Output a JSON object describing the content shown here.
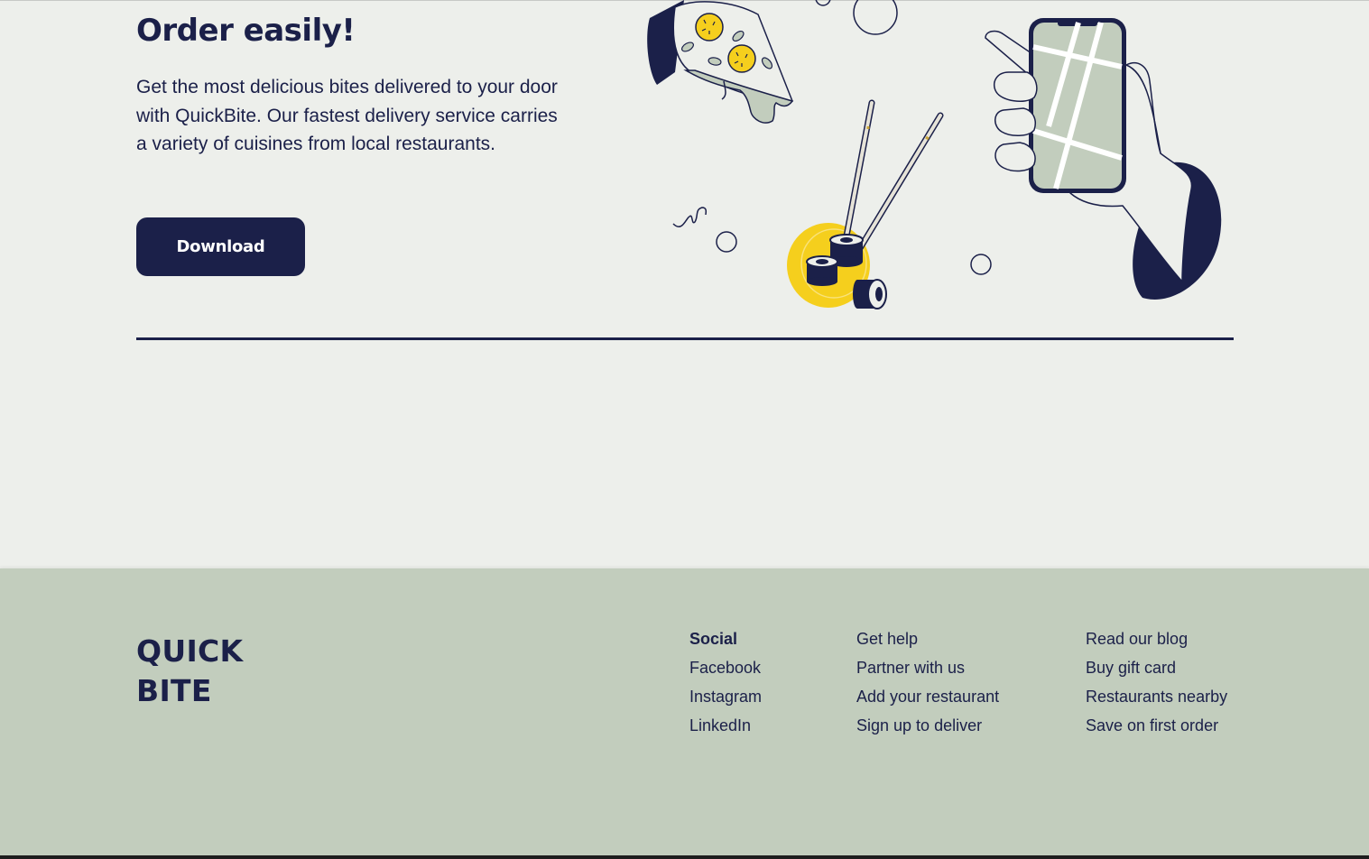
{
  "hero": {
    "title": "Order easily!",
    "description": "Get the most delicious bites delivered to your door with QuickBite. Our fastest delivery service carries a variety of cuisines from local restaurants.",
    "download_label": "Download"
  },
  "footer": {
    "logo_line1": "QUICK",
    "logo_line2": "BITE",
    "social": {
      "heading": "Social",
      "links": [
        "Facebook",
        "Instagram",
        "LinkedIn"
      ]
    },
    "help_links": [
      "Get help",
      "Partner with us",
      "Add your restaurant",
      "Sign up to deliver"
    ],
    "blog_links": [
      "Read our blog",
      "Buy gift card",
      "Restaurants nearby",
      "Save on first order"
    ]
  },
  "colors": {
    "navy": "#1b2049",
    "page_bg": "#edefeb",
    "footer_bg": "#c2cdbd",
    "accent_yellow": "#f5cf1d",
    "sage": "#c2cdbd"
  },
  "icons": [
    "pizza-slice-illustration",
    "sushi-chopsticks-illustration",
    "phone-in-hand-illustration"
  ]
}
